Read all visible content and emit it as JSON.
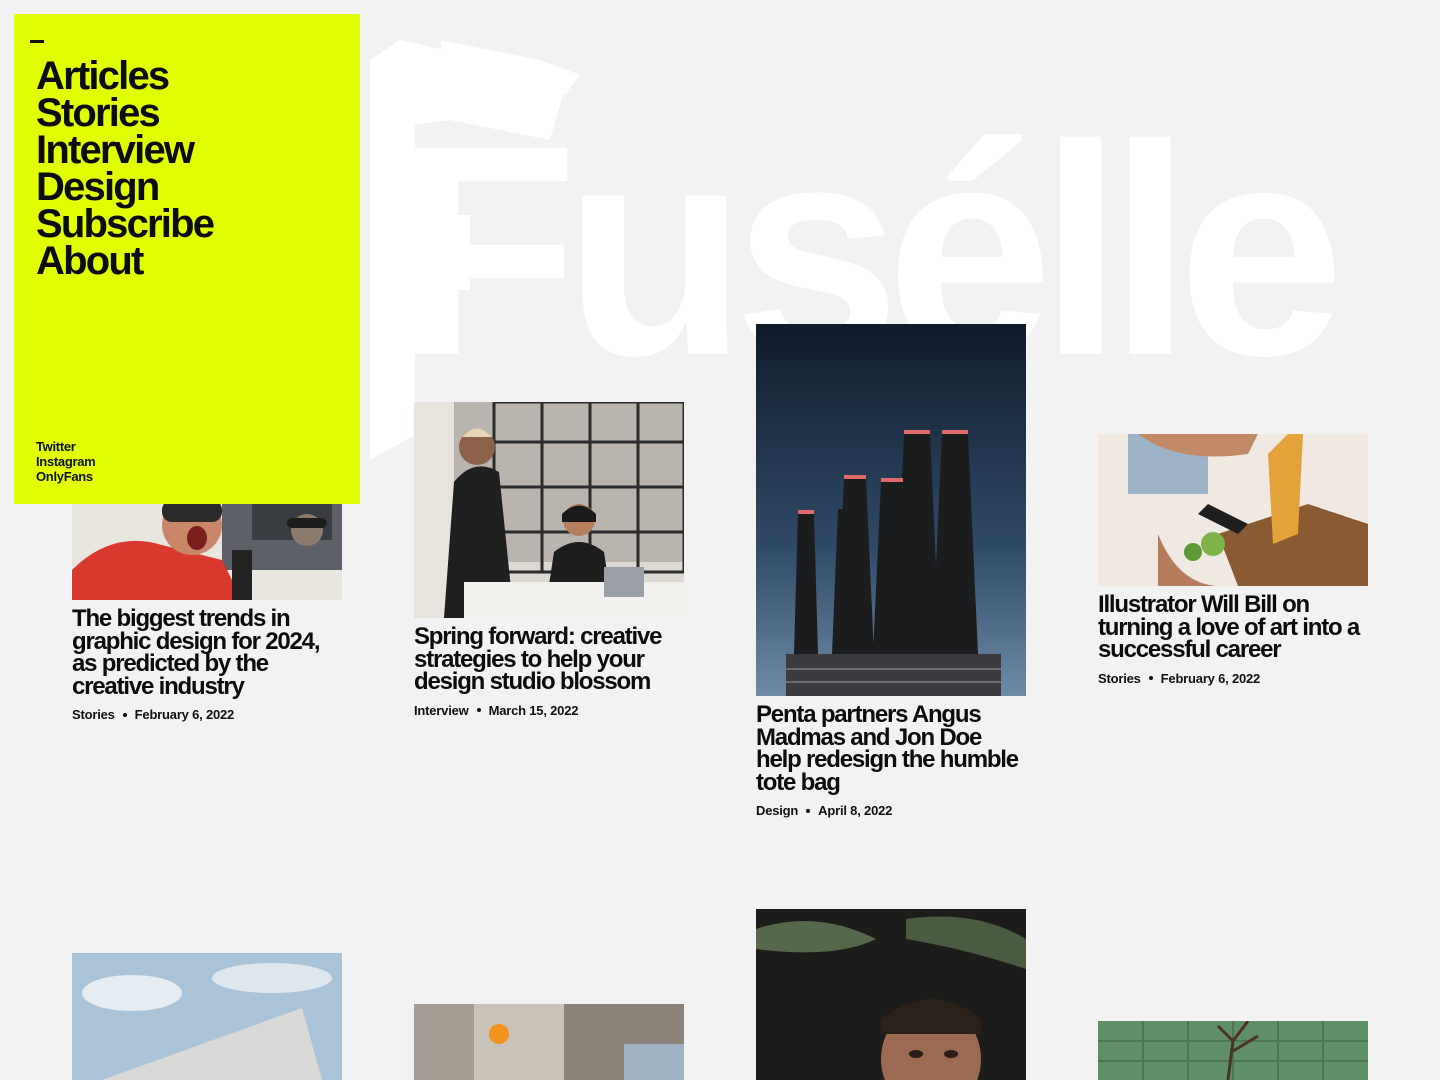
{
  "brand": {
    "wordmark": "Fusélle"
  },
  "menu": {
    "items": [
      {
        "label": "Articles"
      },
      {
        "label": "Stories"
      },
      {
        "label": "Interview"
      },
      {
        "label": "Design"
      },
      {
        "label": "Subscribe"
      },
      {
        "label": "About"
      }
    ],
    "social": [
      {
        "label": "Twitter"
      },
      {
        "label": "Instagram"
      },
      {
        "label": "OnlyFans"
      }
    ],
    "accent_color": "#e1ff00"
  },
  "articles": [
    {
      "title": "The biggest trends in graphic design for 2024, as predicted by the creative industry",
      "category": "Stories",
      "date": "February 6, 2022",
      "image": "racing-driver-photo"
    },
    {
      "title": "Spring forward: creative strategies to help your design studio blossom",
      "category": "Interview",
      "date": "March 15, 2022",
      "image": "studio-conversation-photo"
    },
    {
      "title": "Penta partners Angus Madmas and Jon Doe help redesign the humble tote bag",
      "category": "Design",
      "date": "April 8, 2022",
      "image": "smokestacks-photo"
    },
    {
      "title": "Illustrator Will Bill on turning a love of art into a successful career",
      "category": "Stories",
      "date": "February 6, 2022",
      "image": "tote-bag-photo"
    },
    {
      "image": "sky-sign-photo"
    },
    {
      "image": "orange-still-life-photo"
    },
    {
      "image": "portrait-leaves-photo"
    },
    {
      "image": "green-tiles-tree-photo"
    }
  ]
}
